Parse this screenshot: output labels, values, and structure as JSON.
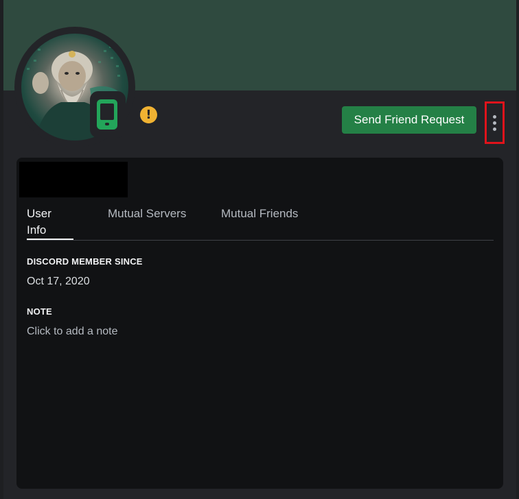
{
  "profile": {
    "send_friend_request_label": "Send Friend Request",
    "warning_glyph": "!",
    "status": "mobile"
  },
  "tabs": [
    {
      "label": "User Info",
      "active": true
    },
    {
      "label": "Mutual Servers",
      "active": false
    },
    {
      "label": "Mutual Friends",
      "active": false
    }
  ],
  "user_info": {
    "member_since_title": "DISCORD MEMBER SINCE",
    "member_since_value": "Oct 17, 2020",
    "note_title": "NOTE",
    "note_placeholder": "Click to add a note"
  },
  "colors": {
    "banner": "#2f4a3f",
    "button": "#248046",
    "status_online": "#23a55a",
    "warning": "#f0b232",
    "highlight": "#e0131b"
  },
  "icons": {
    "more": "vertical-ellipsis",
    "status": "mobile-phone",
    "warning": "exclamation-circle"
  }
}
